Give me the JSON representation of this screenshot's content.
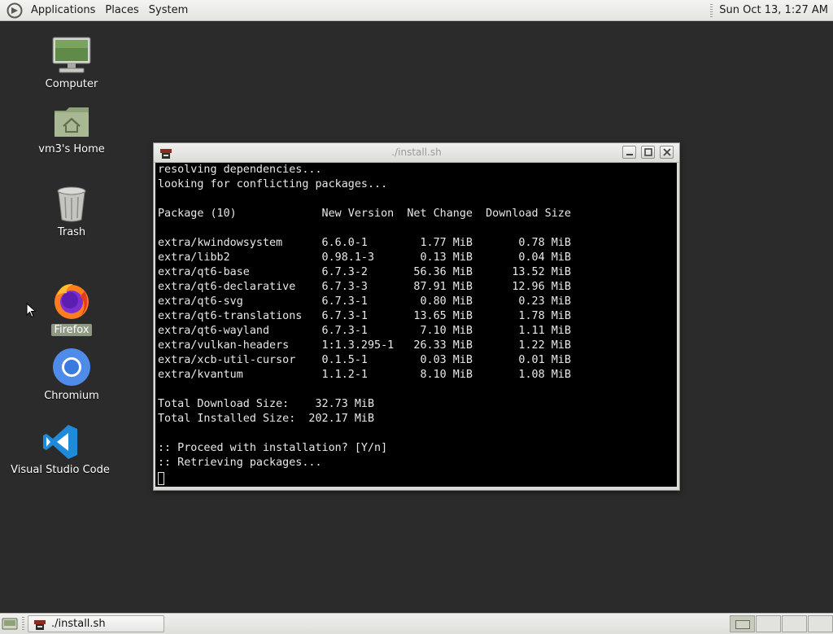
{
  "top_panel": {
    "menus": [
      "Applications",
      "Places",
      "System"
    ],
    "clock": "Sun Oct 13,  1:27 AM"
  },
  "desktop_icons": {
    "computer": "Computer",
    "home": "vm3's Home",
    "trash": "Trash",
    "firefox": "Firefox",
    "chromium": "Chromium",
    "vscode": "Visual Studio Code"
  },
  "terminal": {
    "title": "./install.sh",
    "lines": [
      "resolving dependencies...",
      "looking for conflicting packages...",
      "",
      "Package (10)             New Version  Net Change  Download Size",
      "",
      "extra/kwindowsystem      6.6.0-1        1.77 MiB       0.78 MiB",
      "extra/libb2              0.98.1-3       0.13 MiB       0.04 MiB",
      "extra/qt6-base           6.7.3-2       56.36 MiB      13.52 MiB",
      "extra/qt6-declarative    6.7.3-3       87.91 MiB      12.96 MiB",
      "extra/qt6-svg            6.7.3-1        0.80 MiB       0.23 MiB",
      "extra/qt6-translations   6.7.3-1       13.65 MiB       1.78 MiB",
      "extra/qt6-wayland        6.7.3-1        7.10 MiB       1.11 MiB",
      "extra/vulkan-headers     1:1.3.295-1   26.33 MiB       1.22 MiB",
      "extra/xcb-util-cursor    0.1.5-1        0.03 MiB       0.01 MiB",
      "extra/kvantum            1.1.2-1        8.10 MiB       1.08 MiB",
      "",
      "Total Download Size:    32.73 MiB",
      "Total Installed Size:  202.17 MiB",
      "",
      ":: Proceed with installation? [Y/n]",
      ":: Retrieving packages..."
    ]
  },
  "taskbar": {
    "window_button": "./install.sh"
  },
  "colors": {
    "desktop_bg": "#2b2b2b",
    "terminal_bg": "#000000",
    "terminal_fg": "#e8e8e8",
    "selection": "#8f9a84"
  }
}
